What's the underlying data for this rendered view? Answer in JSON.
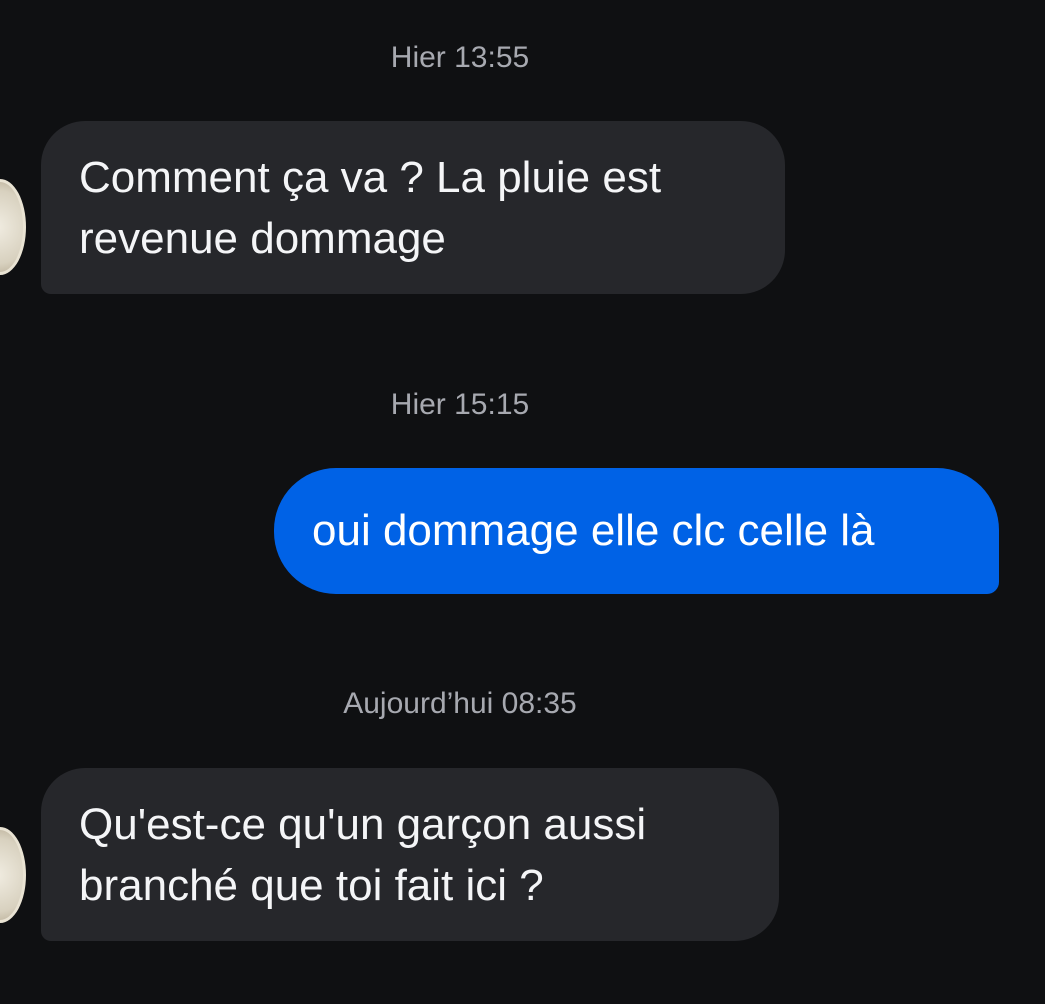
{
  "conversation": {
    "messages": [
      {
        "timestamp": "Hier 13:55",
        "direction": "incoming",
        "text_lines": [
          "Comment ça va ? La pluie est",
          "revenue dommage"
        ]
      },
      {
        "timestamp": "Hier 15:15",
        "direction": "outgoing",
        "text_lines": [
          "oui dommage elle clc celle là"
        ]
      },
      {
        "timestamp": "Aujourd’hui 08:35",
        "direction": "incoming",
        "text_lines": [
          "Qu'est-ce qu'un garçon aussi",
          "branché que toi fait ici ?"
        ]
      }
    ]
  },
  "colors": {
    "background": "#0f1012",
    "incoming_bubble": "#26272b",
    "outgoing_bubble": "#0062e6",
    "timestamp_text": "#a7a9b0",
    "message_text": "#f4f5f7"
  },
  "icons": {
    "avatar": "avatar-icon"
  }
}
